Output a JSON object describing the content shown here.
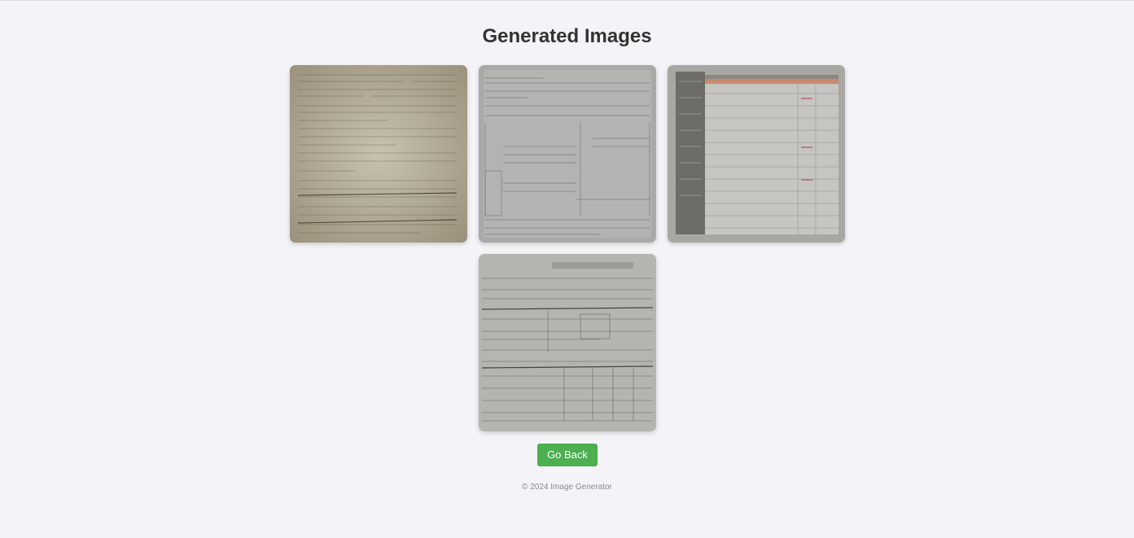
{
  "header": {
    "title": "Generated Images"
  },
  "gallery": {
    "images": [
      {
        "icon": "scanned-form-beige-image",
        "tone": "#b6ae9c"
      },
      {
        "icon": "scanned-form-gray-image",
        "tone": "#a9aaa8"
      },
      {
        "icon": "spreadsheet-screenshot-image",
        "tone": "#b3b2ae"
      },
      {
        "icon": "scanned-table-form-image",
        "tone": "#b4b5b0"
      }
    ]
  },
  "actions": {
    "go_back_label": "Go Back",
    "accent_color": "#4caf50"
  },
  "footer": {
    "text": "© 2024 Image Generator"
  }
}
